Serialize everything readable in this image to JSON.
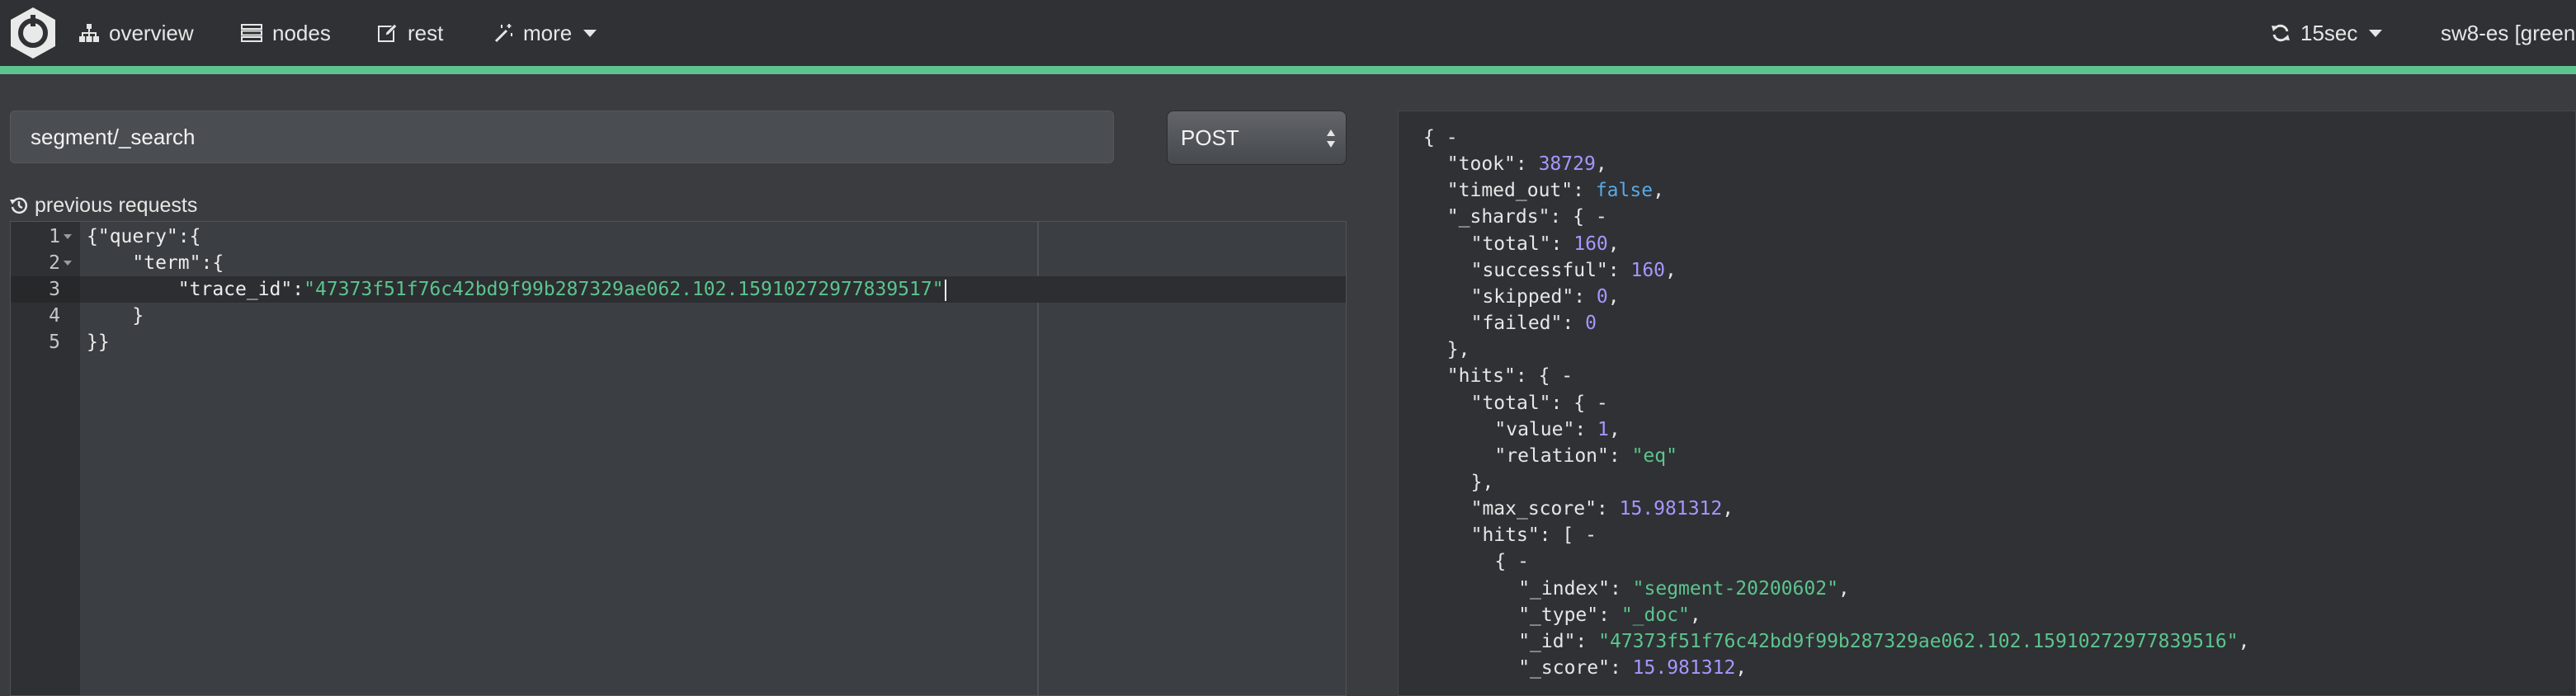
{
  "navbar": {
    "overview_label": "overview",
    "nodes_label": "nodes",
    "rest_label": "rest",
    "more_label": "more",
    "refresh_label": "15sec",
    "cluster_label": "sw8-es [green"
  },
  "colors": {
    "navbar_bg": "#2f3134",
    "progress": "#5cc48e",
    "string": "#5cc48e",
    "number": "#a995ff",
    "boolean": "#5aa8e6"
  },
  "icons": {
    "logo": "cerebro-hexagon-logo",
    "overview": "sitemap-icon",
    "nodes": "server-list-icon",
    "rest": "edit-icon",
    "more": "magic-wand-icon",
    "refresh": "refresh-icon",
    "history": "history-icon"
  },
  "request": {
    "endpoint": "segment/_search",
    "method": "POST",
    "method_options": [
      "POST"
    ],
    "previous_requests_label": "previous requests"
  },
  "editor": {
    "lines": [
      {
        "n": "1",
        "indent": "",
        "text": "{\"query\":{"
      },
      {
        "n": "2",
        "indent": "    ",
        "text": "\"term\":{"
      },
      {
        "n": "3",
        "indent": "        ",
        "key": "\"trace_id\":",
        "value": "\"47373f51f76c42bd9f99b287329ae062.102.15910272977839517\""
      },
      {
        "n": "4",
        "indent": "    ",
        "text": "}"
      },
      {
        "n": "5",
        "indent": "",
        "text": "}}"
      }
    ]
  },
  "response": {
    "lines": [
      {
        "i": 0,
        "k": "",
        "v": "{ -",
        "t": "p"
      },
      {
        "i": 1,
        "k": "\"took\": ",
        "v": "38729",
        "t": "n",
        "c": ","
      },
      {
        "i": 1,
        "k": "\"timed_out\": ",
        "v": "false",
        "t": "b",
        "c": ","
      },
      {
        "i": 1,
        "k": "\"_shards\": ",
        "v": "{ -",
        "t": "p"
      },
      {
        "i": 2,
        "k": "\"total\": ",
        "v": "160",
        "t": "n",
        "c": ","
      },
      {
        "i": 2,
        "k": "\"successful\": ",
        "v": "160",
        "t": "n",
        "c": ","
      },
      {
        "i": 2,
        "k": "\"skipped\": ",
        "v": "0",
        "t": "n",
        "c": ","
      },
      {
        "i": 2,
        "k": "\"failed\": ",
        "v": "0",
        "t": "n"
      },
      {
        "i": 1,
        "k": "",
        "v": "},",
        "t": "p"
      },
      {
        "i": 1,
        "k": "\"hits\": ",
        "v": "{ -",
        "t": "p"
      },
      {
        "i": 2,
        "k": "\"total\": ",
        "v": "{ -",
        "t": "p"
      },
      {
        "i": 3,
        "k": "\"value\": ",
        "v": "1",
        "t": "n",
        "c": ","
      },
      {
        "i": 3,
        "k": "\"relation\": ",
        "v": "\"eq\"",
        "t": "s"
      },
      {
        "i": 2,
        "k": "",
        "v": "},",
        "t": "p"
      },
      {
        "i": 2,
        "k": "\"max_score\": ",
        "v": "15.981312",
        "t": "n",
        "c": ","
      },
      {
        "i": 2,
        "k": "\"hits\": ",
        "v": "[ -",
        "t": "p"
      },
      {
        "i": 3,
        "k": "",
        "v": "{ -",
        "t": "p"
      },
      {
        "i": 4,
        "k": "\"_index\": ",
        "v": "\"segment-20200602\"",
        "t": "s",
        "c": ","
      },
      {
        "i": 4,
        "k": "\"_type\": ",
        "v": "\"_doc\"",
        "t": "s",
        "c": ","
      },
      {
        "i": 4,
        "k": "\"_id\": ",
        "v": "\"47373f51f76c42bd9f99b287329ae062.102.15910272977839516\"",
        "t": "s",
        "c": ","
      },
      {
        "i": 4,
        "k": "\"_score\": ",
        "v": "15.981312",
        "t": "n",
        "c": ","
      }
    ]
  }
}
